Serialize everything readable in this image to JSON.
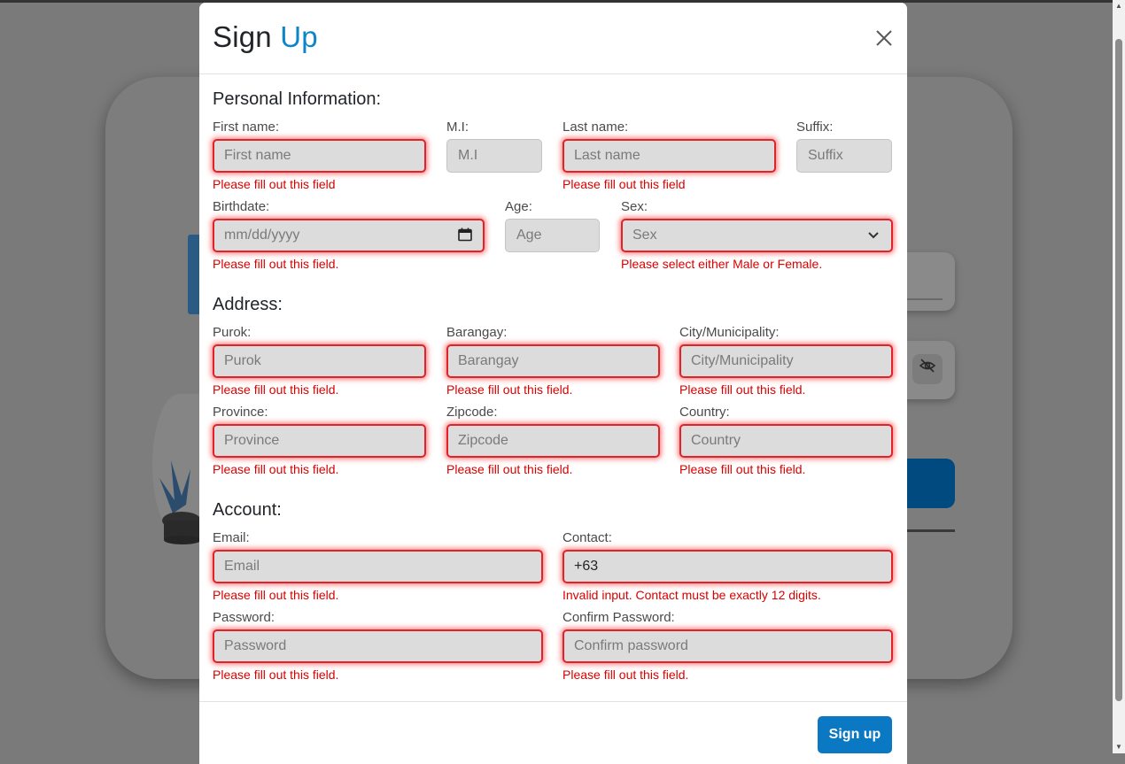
{
  "modal": {
    "title_main": "Sign",
    "title_accent": "Up"
  },
  "sections": {
    "personal": "Personal Information:",
    "address": "Address:",
    "account": "Account:"
  },
  "fields": {
    "first_name": {
      "label": "First name:",
      "placeholder": "First name",
      "error": "Please fill out this field"
    },
    "mi": {
      "label": "M.I:",
      "placeholder": "M.I"
    },
    "last_name": {
      "label": "Last name:",
      "placeholder": "Last name",
      "error": "Please fill out this field"
    },
    "suffix": {
      "label": "Suffix:",
      "placeholder": "Suffix"
    },
    "birthdate": {
      "label": "Birthdate:",
      "placeholder": "mm/dd/yyyy",
      "error": "Please fill out this field."
    },
    "age": {
      "label": "Age:",
      "placeholder": "Age"
    },
    "sex": {
      "label": "Sex:",
      "selected": "Sex",
      "error": "Please select either Male or Female."
    },
    "purok": {
      "label": "Purok:",
      "placeholder": "Purok",
      "error": "Please fill out this field."
    },
    "barangay": {
      "label": "Barangay:",
      "placeholder": "Barangay",
      "error": "Please fill out this field."
    },
    "city": {
      "label": "City/Municipality:",
      "placeholder": "City/Municipality",
      "error": "Please fill out this field."
    },
    "province": {
      "label": "Province:",
      "placeholder": "Province",
      "error": "Please fill out this field."
    },
    "zipcode": {
      "label": "Zipcode:",
      "placeholder": "Zipcode",
      "error": "Please fill out this field."
    },
    "country": {
      "label": "Country:",
      "placeholder": "Country",
      "error": "Please fill out this field."
    },
    "email": {
      "label": "Email:",
      "placeholder": "Email",
      "error": "Please fill out this field."
    },
    "contact": {
      "label": "Contact:",
      "value": "+63",
      "error": "Invalid input. Contact must be exactly 12 digits."
    },
    "password": {
      "label": "Password:",
      "placeholder": "Password",
      "error": "Please fill out this field."
    },
    "confirm_password": {
      "label": "Confirm Password:",
      "placeholder": "Confirm password",
      "error": "Please fill out this field."
    }
  },
  "footer": {
    "signup_label": "Sign up"
  },
  "icons": {
    "close": "close-icon",
    "calendar": "calendar-icon",
    "chevron": "chevron-down-icon",
    "eye_slash": "eye-slash-icon"
  },
  "colors": {
    "accent": "#0d85c9",
    "error": "#d90000",
    "button": "#0a78c2"
  }
}
